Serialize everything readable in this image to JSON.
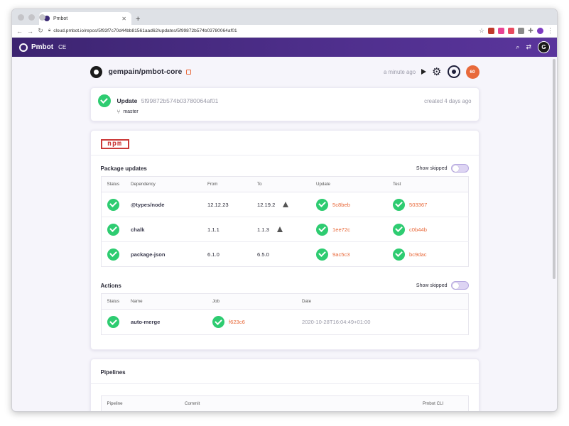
{
  "browser": {
    "tab_title": "Pmbot",
    "url": "cloud.pmbot.io/repos/5f93f7c70d44bb81561aad62/updates/5f99872b574b03780064af01"
  },
  "app": {
    "brand": "Pmbot",
    "edition": "CE",
    "avatar_initial": "G",
    "brand_color": "#4f2f8d"
  },
  "repo": {
    "name": "gempain/pmbot-core",
    "last_updated": "a minute ago",
    "score": "60"
  },
  "update": {
    "label": "Update",
    "hash": "5f99872b574b03780064af01",
    "branch": "master",
    "created": "created 4 days ago"
  },
  "package_manager": {
    "logo_text": "npm"
  },
  "package_updates": {
    "title": "Package updates",
    "show_skipped": "Show skipped",
    "columns": [
      "Status",
      "Dependency",
      "From",
      "To",
      "Update",
      "Test"
    ],
    "rows": [
      {
        "dependency": "@types/node",
        "from": "12.12.23",
        "to": "12.19.2",
        "update": "5c8beb",
        "test": "503367"
      },
      {
        "dependency": "chalk",
        "from": "1.1.1",
        "to": "1.1.3",
        "update": "1ee72c",
        "test": "c0b44b"
      },
      {
        "dependency": "package-json",
        "from": "6.1.0",
        "to": "6.5.0",
        "update": "9ac5c3",
        "test": "bc9dac"
      }
    ]
  },
  "actions": {
    "title": "Actions",
    "show_skipped": "Show skipped",
    "columns": [
      "Status",
      "Name",
      "Job",
      "Date"
    ],
    "rows": [
      {
        "name": "auto-merge",
        "job": "f623c6",
        "date": "2020-10-28T16:04:49+01:00"
      }
    ]
  },
  "pipelines": {
    "title": "Pipelines",
    "columns": [
      "Pipeline",
      "Commit",
      "Pmbot CLI"
    ]
  }
}
